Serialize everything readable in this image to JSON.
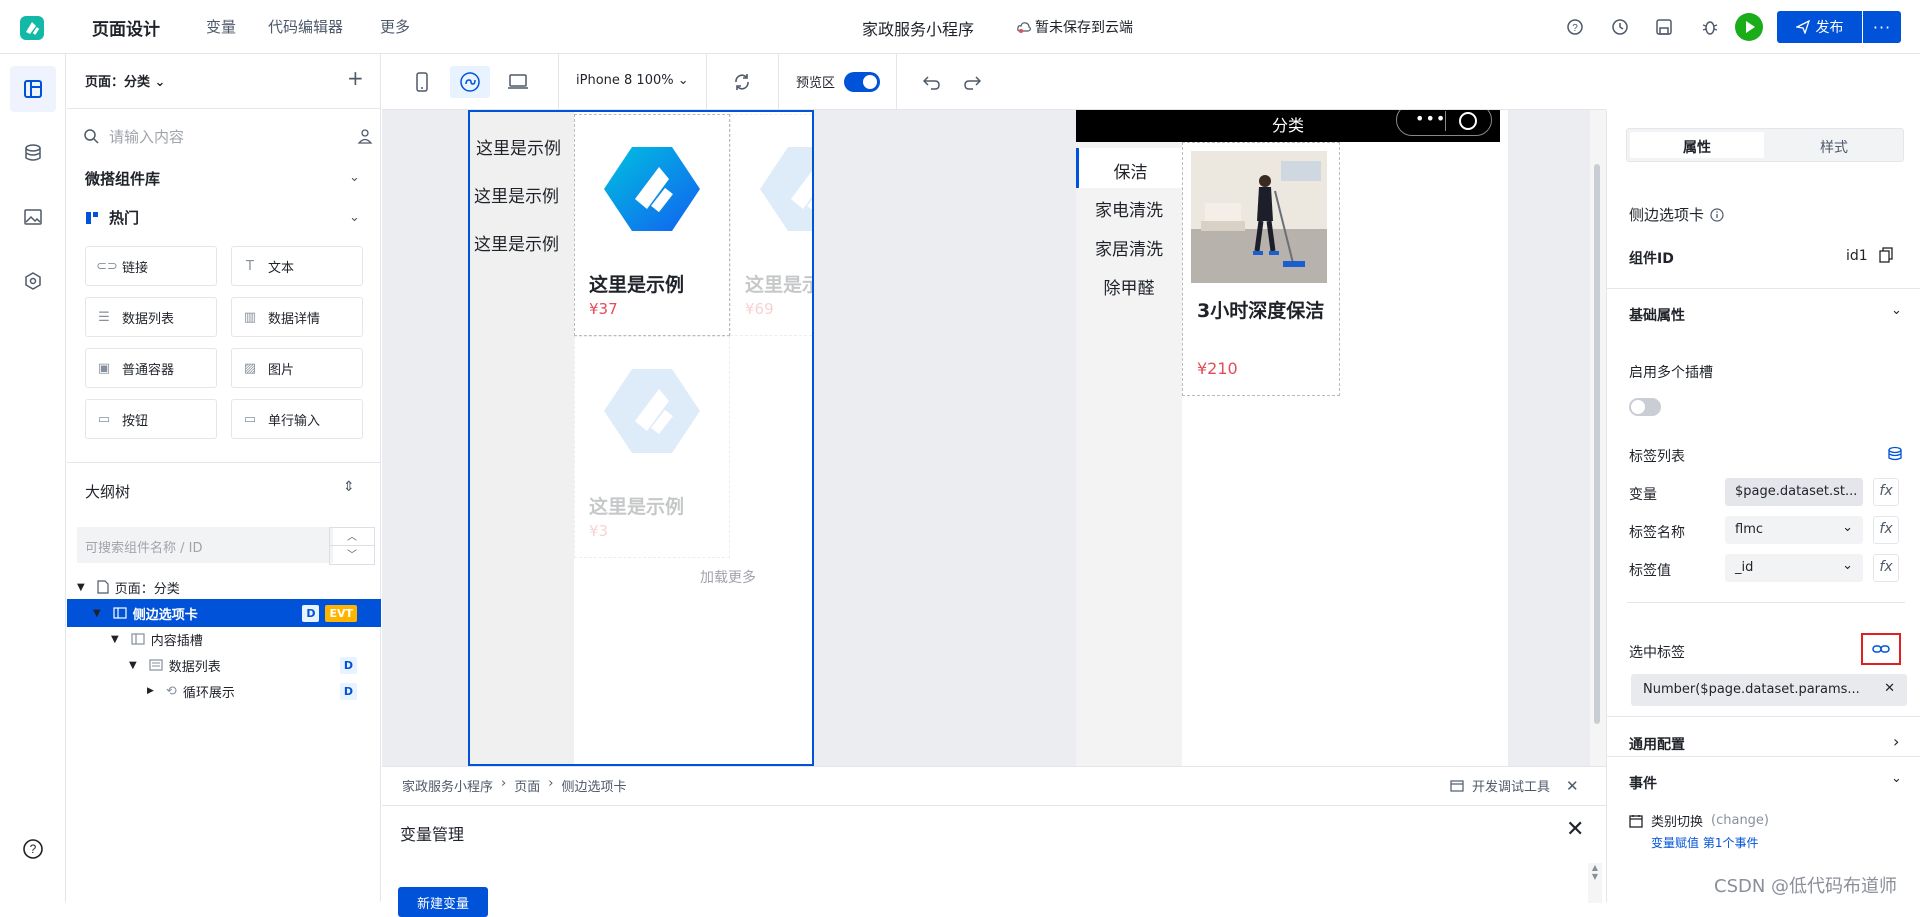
{
  "topbar": {
    "title": "页面设计",
    "nav": [
      "变量",
      "代码编辑器",
      "更多"
    ],
    "app_name": "家政服务小程序",
    "save_status": "暂未保存到云端",
    "publish_label": "发布",
    "more_label": "···"
  },
  "comp_panel": {
    "page_select": "页面：分类",
    "search_placeholder": "请输入内容",
    "library_title": "微搭组件库",
    "hot_title": "热门",
    "items": [
      "链接",
      "文本",
      "数据列表",
      "数据详情",
      "普通容器",
      "图片",
      "按钮",
      "单行输入"
    ]
  },
  "outline": {
    "title": "大纲树",
    "search_placeholder": "可搜索组件名称 / ID",
    "nodes": [
      {
        "label": "页面：分类"
      },
      {
        "label": "侧边选项卡",
        "badges": [
          "D",
          "EVT"
        ]
      },
      {
        "label": "内容插槽"
      },
      {
        "label": "数据列表",
        "badges": [
          "D"
        ]
      },
      {
        "label": "循环展示",
        "badges": [
          "D"
        ]
      }
    ]
  },
  "toolbar": {
    "device": "iPhone 8 100%",
    "preview_label": "预览区"
  },
  "canvas": {
    "phone1": {
      "tabs": [
        "这里是示例",
        "这里是示例",
        "这里是示例"
      ],
      "cards": [
        {
          "title": "这里是示例",
          "price": "¥37"
        },
        {
          "title": "这里是示例",
          "price": "¥69"
        },
        {
          "title": "这里是示例",
          "price": "¥3"
        }
      ],
      "load_more": "加载更多"
    },
    "phone2": {
      "title": "分类",
      "tabs": [
        "保洁",
        "家电清洗",
        "家居清洗",
        "除甲醛"
      ],
      "card": {
        "name": "3小时深度保洁",
        "price": "¥210"
      }
    }
  },
  "bottom": {
    "breadcrumb": [
      "家政服务小程序",
      "页面",
      "侧边选项卡"
    ],
    "devtools": "开发调试工具",
    "var_title": "变量管理",
    "new_var": "新建变量"
  },
  "right_panel": {
    "tabs": [
      "属性",
      "样式"
    ],
    "component_title": "侧边选项卡",
    "component_id_label": "组件ID",
    "component_id": "id1",
    "basic_props": "基础属性",
    "multi_slot": "启用多个插槽",
    "tab_list": "标签列表",
    "var_label": "变量",
    "var_value": "$page.dataset.st...",
    "name_label": "标签名称",
    "name_value": "flmc",
    "value_label": "标签值",
    "value_value": "_id",
    "selected_label": "选中标签",
    "selected_value": "Number($page.dataset.params...",
    "general_config": "通用配置",
    "events": "事件",
    "event_name": "类别切换",
    "event_code": "(change)",
    "event_sub": "变量赋值 第1个事件"
  },
  "watermark": "CSDN @低代码布道师",
  "colors": {
    "primary": "#0052d9",
    "price": "#e34d59",
    "run": "#1aad19"
  }
}
